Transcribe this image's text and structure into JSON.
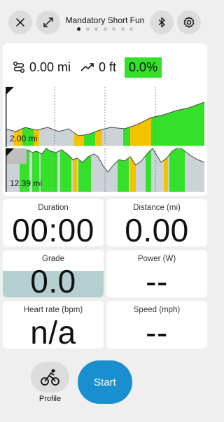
{
  "header": {
    "title": "Mandatory Short Fun",
    "page_dots": 7,
    "active_dot": 0,
    "close_icon": "close-icon",
    "fullscreen_icon": "expand-arrows-icon",
    "bluetooth_icon": "bluetooth-icon",
    "settings_icon": "gear-icon"
  },
  "summary": {
    "distance": "0.00 mi",
    "elevation": "0 ft",
    "grade": "0.0%",
    "grade_color": "#35e02a"
  },
  "profile": {
    "upper_label": "2.00 mi",
    "lower_label": "12.39 mi"
  },
  "tiles": {
    "duration": {
      "label": "Duration",
      "value": "00:00"
    },
    "distance": {
      "label": "Distance (mi)",
      "value": "0.00"
    },
    "grade": {
      "label": "Grade",
      "value": "0.0",
      "fill_color": "#b3cfd0"
    },
    "power": {
      "label": "Power (W)",
      "value": "--"
    },
    "heart_rate": {
      "label": "Heart rate (bpm)",
      "value": "n/a"
    },
    "speed": {
      "label": "Speed (mph)",
      "value": "--"
    }
  },
  "actions": {
    "profile_label": "Profile",
    "start_label": "Start",
    "start_color": "#1a8fcf",
    "profile_icon": "cyclist-icon"
  }
}
